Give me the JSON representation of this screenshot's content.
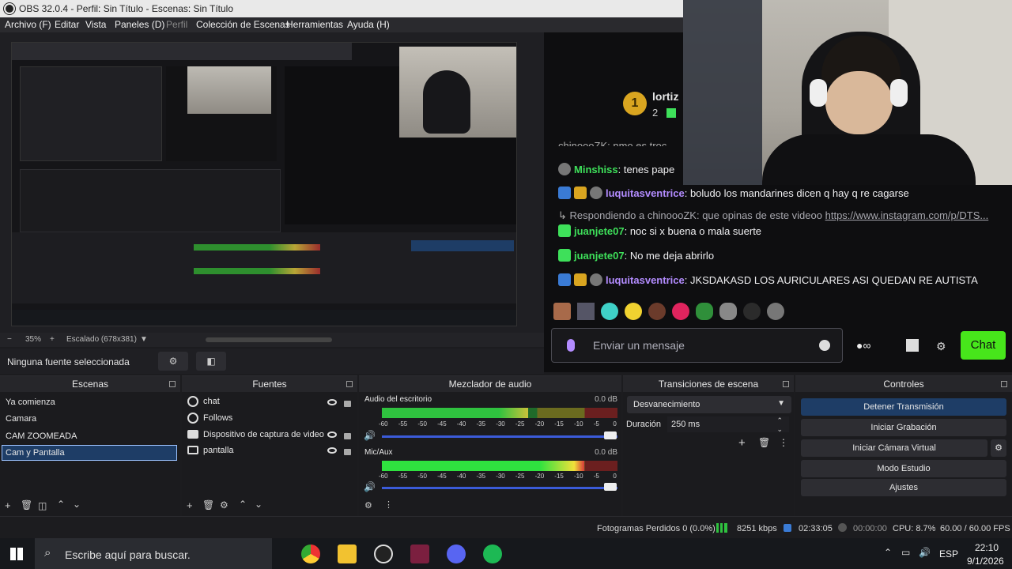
{
  "window_title": "OBS 32.0.4 - Perfil: Sin Título - Escenas: Sin Título",
  "menu": [
    "Archivo (F)",
    "Editar",
    "Vista",
    "Paneles (D)",
    "Perfil",
    "Colección de Escenas",
    "Herramientas",
    "Ayuda (H)"
  ],
  "preview": {
    "zoom": "35%",
    "scale_mode": "Escalado (678x381)",
    "no_source": "Ninguna fuente seleccionada"
  },
  "stream": {
    "streamer": "lortiz",
    "rank": "1",
    "count": "2",
    "partial_line": "chinoooZK: nmo es troc",
    "messages": [
      {
        "user": "Minshiss",
        "text": "tenes pape",
        "color": "green"
      },
      {
        "user": "luquitasventrice",
        "text": "boludo los mandarines dicen q hay q re cagarse",
        "color": "purple"
      },
      {
        "reply": "Respondiendo a chinoooZK: que opinas de este videoo",
        "link": "https://www.instagram.com/p/DTS..."
      },
      {
        "user": "juanjete07",
        "text": "noc si x buena o mala suerte",
        "color": "green"
      },
      {
        "user": "juanjete07",
        "text": "No me deja abrirlo",
        "color": "green"
      },
      {
        "user": "luquitasventrice",
        "text": "JKSDAKASD LOS AURICULARES ASI QUEDAN RE AUTISTA",
        "color": "purple"
      }
    ],
    "input_placeholder": "Enviar un mensaje",
    "chat_button": "Chat"
  },
  "docks": {
    "scenes": {
      "title": "Escenas",
      "items": [
        "Ya comienza",
        "Camara",
        "CAM ZOOMEADA",
        "Cam y Pantalla"
      ],
      "selected": "Cam y Pantalla"
    },
    "sources": {
      "title": "Fuentes",
      "items": [
        {
          "name": "chat",
          "icon": "globe-icon"
        },
        {
          "name": "Follows",
          "icon": "globe-icon"
        },
        {
          "name": "Dispositivo de captura de video",
          "icon": "camera-icon"
        },
        {
          "name": "pantalla",
          "icon": "monitor-icon"
        }
      ]
    },
    "mixer": {
      "title": "Mezclador de audio",
      "channels": [
        {
          "name": "Audio del escritorio",
          "db": "0.0 dB",
          "level": 0.62
        },
        {
          "name": "Mic/Aux",
          "db": "0.0 dB",
          "level": 0.86
        }
      ],
      "ticks": [
        "-60",
        "-55",
        "-50",
        "-45",
        "-40",
        "-35",
        "-30",
        "-25",
        "-20",
        "-15",
        "-10",
        "-5",
        "0"
      ]
    },
    "transitions": {
      "title": "Transiciones de escena",
      "selected": "Desvanecimiento",
      "duration_label": "Duración",
      "duration_value": "250 ms"
    },
    "controls": {
      "title": "Controles",
      "buttons": [
        "Detener Transmisión",
        "Iniciar Grabación",
        "Iniciar Cámara Virtual",
        "Modo Estudio",
        "Ajustes"
      ]
    }
  },
  "status": {
    "dropped": "Fotogramas Perdidos 0 (0.0%)",
    "bitrate": "8251 kbps",
    "stream_time": "02:33:05",
    "rec_time": "00:00:00",
    "cpu": "CPU: 8.7%",
    "fps": "60.00 / 60.00 FPS"
  },
  "taskbar": {
    "search_placeholder": "Escribe aquí para buscar.",
    "lang": "ESP",
    "time": "22:10",
    "date": "9/1/2026"
  },
  "colors": {
    "accent_green": "#3ee05a",
    "twitch_purple": "#b38cff",
    "chat_btn": "#47e61b",
    "selected_blue": "#1e3d66"
  }
}
